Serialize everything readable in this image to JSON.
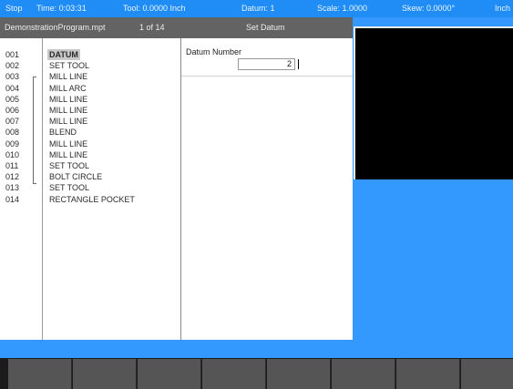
{
  "status_bar": {
    "mode": "Stop",
    "time": "Time: 0:03:31",
    "tool": "Tool: 0.0000 Inch",
    "datum": "Datum: 1",
    "scale": "Scale: 1.0000",
    "skew": "Skew: 0.0000°",
    "units": "Inch"
  },
  "title_bar": {
    "program_name": "DemonstrationProgram.mpt",
    "position": "1 of 14",
    "form_title": "Set Datum"
  },
  "program_list": [
    {
      "num": "001",
      "cmd": "DATUM",
      "selected": true
    },
    {
      "num": "002",
      "cmd": "SET TOOL"
    },
    {
      "num": "003",
      "cmd": "MILL LINE"
    },
    {
      "num": "004",
      "cmd": "MILL ARC"
    },
    {
      "num": "005",
      "cmd": "MILL LINE"
    },
    {
      "num": "006",
      "cmd": "MILL LINE"
    },
    {
      "num": "007",
      "cmd": "MILL LINE"
    },
    {
      "num": "008",
      "cmd": "BLEND"
    },
    {
      "num": "009",
      "cmd": "MILL LINE"
    },
    {
      "num": "010",
      "cmd": "MILL LINE"
    },
    {
      "num": "011",
      "cmd": "SET TOOL"
    },
    {
      "num": "012",
      "cmd": "BOLT CIRCLE"
    },
    {
      "num": "013",
      "cmd": "SET TOOL"
    },
    {
      "num": "014",
      "cmd": "RECTANGLE POCKET"
    }
  ],
  "form": {
    "field_label": "Datum Number",
    "field_value": "2"
  },
  "softkeys": [
    "",
    "",
    "",
    "",
    "",
    "",
    "",
    ""
  ],
  "colors": {
    "background": "#3399ff",
    "status_bar": "#1f8df5",
    "title_bar": "#636363",
    "selection": "#c9c9c9",
    "softkey": "#555555"
  }
}
